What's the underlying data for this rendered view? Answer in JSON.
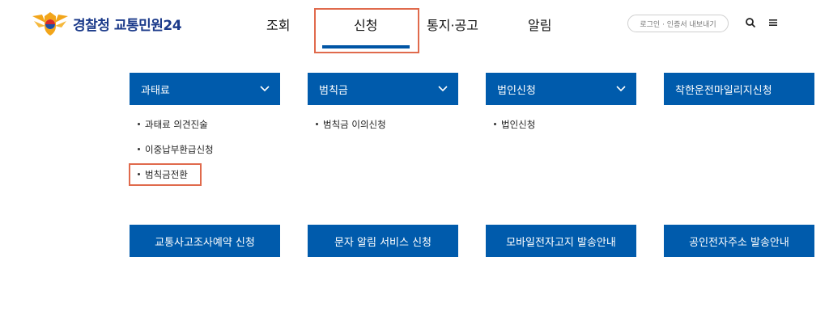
{
  "header": {
    "brand_part1": "경찰청",
    "brand_part2": "교통민원24",
    "nav": [
      "조회",
      "신청",
      "통지·공고",
      "알림"
    ],
    "active_nav": "신청",
    "login_label": "로그인 · 인증서 내보내기",
    "icons": [
      "search-icon",
      "menu-icon"
    ]
  },
  "menus": [
    {
      "title": "과태료",
      "items": [
        "과태료 의견진술",
        "이중납부환급신청",
        "범칙금전환"
      ]
    },
    {
      "title": "범칙금",
      "items": [
        "범칙금 이의신청"
      ]
    },
    {
      "title": "법인신청",
      "items": [
        "법인신청"
      ]
    },
    {
      "title": "착한운전마일리지신청",
      "items": []
    }
  ],
  "bottom_menus": [
    "교통사고조사예약 신청",
    "문자 알림 서비스 신청",
    "모바일전자고지 발송안내",
    "공인전자주소 발송안내"
  ],
  "colors": {
    "primary": "#005bac",
    "highlight": "#e06a4c",
    "brand": "#1b3a8a"
  }
}
